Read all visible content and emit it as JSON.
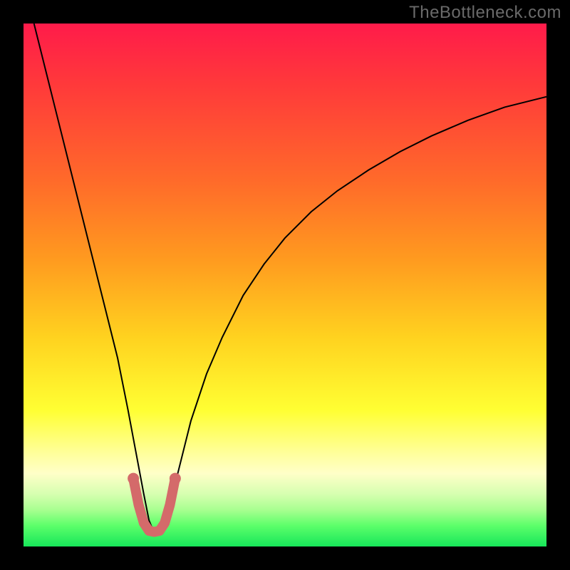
{
  "watermark": "TheBottleneck.com",
  "chart_data": {
    "type": "line",
    "title": "",
    "xlabel": "",
    "ylabel": "",
    "xlim": [
      0,
      100
    ],
    "ylim": [
      0,
      100
    ],
    "grid": false,
    "legend": false,
    "description": "Bottleneck curve: a V-shaped black curve with minimum near x≈25, over a vertical rainbow gradient (red at top through orange/yellow to green at bottom). A short salmon U-shaped highlight marks the trough region.",
    "gradient_stops": [
      {
        "offset": 0.0,
        "color": "#ff1b4a"
      },
      {
        "offset": 0.12,
        "color": "#ff3a3a"
      },
      {
        "offset": 0.3,
        "color": "#ff6a2a"
      },
      {
        "offset": 0.45,
        "color": "#ff9a1f"
      },
      {
        "offset": 0.6,
        "color": "#ffd21f"
      },
      {
        "offset": 0.74,
        "color": "#ffff33"
      },
      {
        "offset": 0.82,
        "color": "#ffff99"
      },
      {
        "offset": 0.86,
        "color": "#ffffc8"
      },
      {
        "offset": 0.9,
        "color": "#d6ffb0"
      },
      {
        "offset": 0.93,
        "color": "#a8ff90"
      },
      {
        "offset": 0.96,
        "color": "#5cff6a"
      },
      {
        "offset": 1.0,
        "color": "#17e65a"
      }
    ],
    "series": [
      {
        "name": "bottleneck-curve",
        "color": "#000000",
        "stroke_width": 2,
        "x": [
          2,
          4,
          6,
          8,
          10,
          12,
          14,
          16,
          18,
          20,
          21.5,
          23,
          24,
          25,
          26,
          27,
          28.5,
          30,
          32,
          35,
          38,
          42,
          46,
          50,
          55,
          60,
          66,
          72,
          78,
          85,
          92,
          100
        ],
        "y": [
          100,
          92,
          84,
          76,
          68,
          60,
          52,
          44,
          36,
          26,
          18,
          10,
          5,
          2.5,
          2.5,
          5,
          10,
          16,
          24,
          33,
          40,
          48,
          54,
          59,
          64,
          68,
          72,
          75.5,
          78.5,
          81.5,
          84,
          86
        ]
      },
      {
        "name": "trough-highlight",
        "color": "#d46a6a",
        "stroke_width": 14,
        "linecap": "round",
        "x": [
          21.0,
          22.0,
          23.0,
          24.0,
          25.0,
          26.0,
          27.0,
          28.0,
          29.0
        ],
        "y": [
          13.0,
          8.0,
          4.5,
          3.0,
          2.8,
          3.0,
          4.5,
          8.0,
          13.0
        ]
      }
    ]
  }
}
